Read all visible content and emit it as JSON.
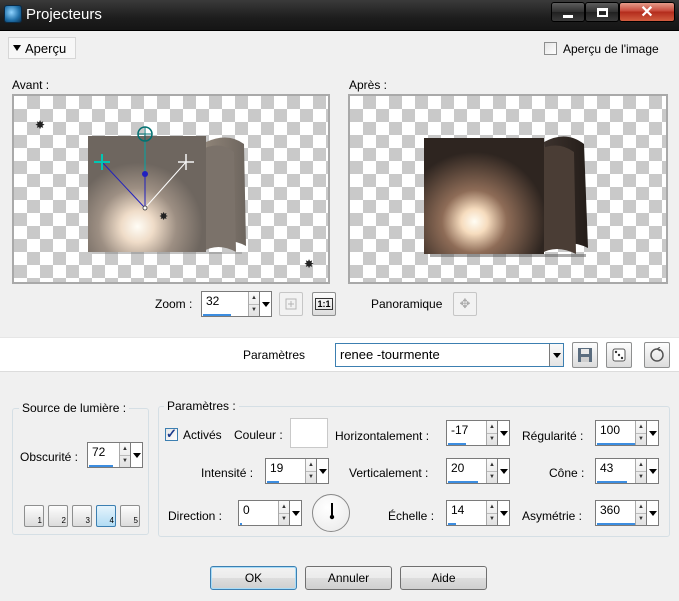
{
  "window": {
    "title": "Projecteurs"
  },
  "preview_header": {
    "toggle_label": "Aperçu",
    "image_preview_label": "Aperçu de l'image",
    "image_preview_checked": false
  },
  "previews": {
    "before_label": "Avant :",
    "after_label": "Après :"
  },
  "zoom": {
    "label": "Zoom :",
    "value": "32",
    "actual_size_label": "1:1",
    "pan_label": "Panoramique"
  },
  "presets": {
    "label": "Paramètres",
    "value": "renee -tourmente"
  },
  "light_source": {
    "title": "Source de lumière :",
    "darkness_label": "Obscurité :",
    "darkness_value": "72",
    "lights": [
      "1",
      "2",
      "3",
      "4",
      "5"
    ],
    "active_light": "4"
  },
  "params": {
    "title": "Paramètres :",
    "enabled_label": "Activés",
    "enabled_checked": true,
    "color_label": "Couleur :",
    "intensity_label": "Intensité :",
    "intensity_value": "19",
    "direction_label": "Direction :",
    "direction_value": "0",
    "horizontal_label": "Horizontalement :",
    "horizontal_value": "-17",
    "vertical_label": "Verticalement :",
    "vertical_value": "20",
    "scale_label": "Échelle :",
    "scale_value": "14",
    "regularity_label": "Régularité :",
    "regularity_value": "100",
    "cone_label": "Cône :",
    "cone_value": "43",
    "asymmetry_label": "Asymétrie :",
    "asymmetry_value": "360"
  },
  "buttons": {
    "ok": "OK",
    "cancel": "Annuler",
    "help": "Aide"
  }
}
